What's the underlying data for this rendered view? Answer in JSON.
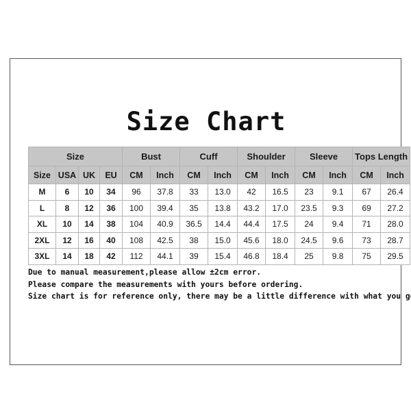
{
  "document": {
    "title": "Size Chart"
  },
  "table": {
    "group_headers": [
      {
        "label": "Size",
        "span": 4
      },
      {
        "label": "Bust",
        "span": 2
      },
      {
        "label": "Cuff",
        "span": 2
      },
      {
        "label": "Shoulder",
        "span": 2
      },
      {
        "label": "Sleeve",
        "span": 2
      },
      {
        "label": "Tops Length",
        "span": 2
      }
    ],
    "sub_headers": [
      "Size",
      "USA",
      "UK",
      "EU",
      "CM",
      "Inch",
      "CM",
      "Inch",
      "CM",
      "Inch",
      "CM",
      "Inch",
      "CM",
      "Inch"
    ],
    "rows": [
      [
        "M",
        "6",
        "10",
        "34",
        "96",
        "37.8",
        "33",
        "13.0",
        "42",
        "16.5",
        "23",
        "9.1",
        "67",
        "26.4"
      ],
      [
        "L",
        "8",
        "12",
        "36",
        "100",
        "39.4",
        "35",
        "13.8",
        "43.2",
        "17.0",
        "23.5",
        "9.3",
        "69",
        "27.2"
      ],
      [
        "XL",
        "10",
        "14",
        "38",
        "104",
        "40.9",
        "36.5",
        "14.4",
        "44.4",
        "17.5",
        "24",
        "9.4",
        "71",
        "28.0"
      ],
      [
        "2XL",
        "12",
        "16",
        "40",
        "108",
        "42.5",
        "38",
        "15.0",
        "45.6",
        "18.0",
        "24.5",
        "9.6",
        "73",
        "28.7"
      ],
      [
        "3XL",
        "14",
        "18",
        "42",
        "112",
        "44.1",
        "39",
        "15.4",
        "46.8",
        "18.4",
        "25",
        "9.8",
        "75",
        "29.5"
      ]
    ]
  },
  "notes": [
    "Due to manual measurement,please allow ±2cm error.",
    "Please compare the measurements with yours before ordering.",
    "Size chart is for reference only, there may be a little difference with what you get."
  ],
  "colors": {
    "header_background": "#c6c6c6",
    "grid_line": "#b3b3b3",
    "frame_border": "#555555",
    "text": "#1a1a1a",
    "page_background": "#ffffff"
  }
}
